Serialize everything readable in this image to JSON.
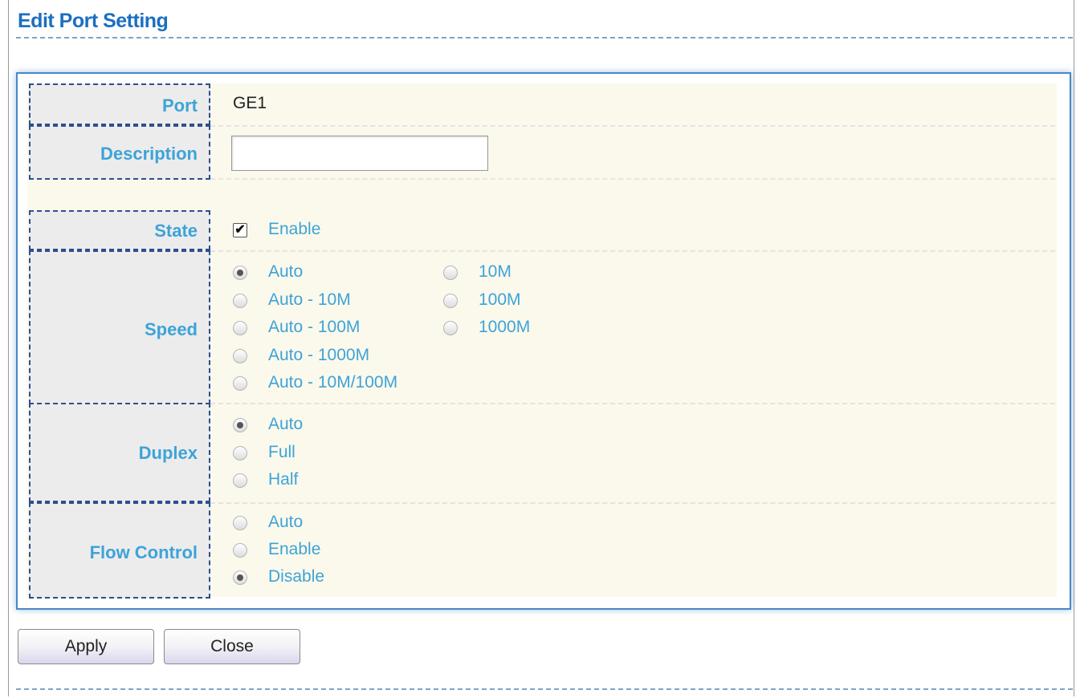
{
  "page": {
    "title": "Edit Port Setting"
  },
  "fields": {
    "port": {
      "label": "Port",
      "value": "GE1"
    },
    "description": {
      "label": "Description",
      "value": "",
      "placeholder": ""
    },
    "state": {
      "label": "State",
      "option_label": "Enable",
      "checked": true
    },
    "speed": {
      "label": "Speed",
      "selected": "Auto",
      "options": [
        "Auto",
        "Auto - 10M",
        "Auto - 100M",
        "Auto - 1000M",
        "Auto - 10M/100M",
        "10M",
        "100M",
        "1000M"
      ]
    },
    "duplex": {
      "label": "Duplex",
      "selected": "Auto",
      "options": [
        "Auto",
        "Full",
        "Half"
      ]
    },
    "flow_control": {
      "label": "Flow Control",
      "selected": "Disable",
      "options": [
        "Auto",
        "Enable",
        "Disable"
      ]
    }
  },
  "buttons": {
    "apply": "Apply",
    "close": "Close"
  },
  "colors": {
    "title": "#1c6fc0",
    "label": "#3da3d8",
    "panel_border": "#4a86c5",
    "content_bg": "#fbf9ec",
    "label_bg": "#ececec"
  }
}
